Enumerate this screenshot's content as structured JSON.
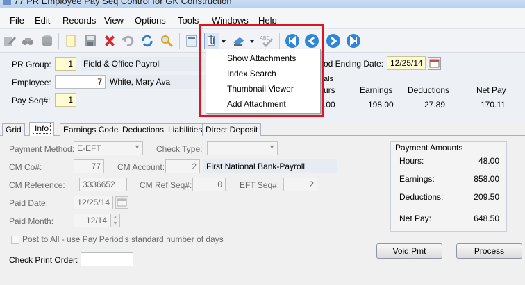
{
  "window": {
    "title": "77 PR Employee Pay Seq Control for GK Construction"
  },
  "menu": [
    "File",
    "Edit",
    "Records",
    "View",
    "Options",
    "Tools",
    "Windows",
    "Help"
  ],
  "header": {
    "pr_group_label": "PR Group:",
    "pr_group_value": "1",
    "pr_group_desc": "Field & Office Payroll",
    "employee_label": "Employee:",
    "employee_value": "7",
    "employee_name": "White, Mary Ava",
    "payseq_label": "Pay Seq#:",
    "payseq_value": "1",
    "period_ending_label": "od Ending Date:",
    "period_ending_value": "12/25/14",
    "totals_label": "als",
    "totals_headers": [
      "urs",
      "Earnings",
      "Deductions",
      "Net Pay"
    ],
    "totals_values": [
      ".00",
      "198.00",
      "27.89",
      "170.11"
    ]
  },
  "attachments_menu": {
    "items": [
      "Show Attachments",
      "Index Search",
      "Thumbnail Viewer",
      "Add Attachment"
    ]
  },
  "tabs": [
    "Grid",
    "Info",
    "Earnings Codes",
    "Deductions",
    "Liabilities",
    "Direct Deposit"
  ],
  "info": {
    "payment_method_label": "Payment Method:",
    "payment_method_value": "E-EFT",
    "check_type_label": "Check Type:",
    "check_type_value": "",
    "cm_co_label": "CM Co#:",
    "cm_co_value": "77",
    "cm_account_label": "CM Account:",
    "cm_account_value": "2",
    "cm_account_desc": "First National Bank-Payroll",
    "cm_reference_label": "CM Reference:",
    "cm_reference_value": "3336652",
    "cm_ref_seq_label": "CM Ref Seq#:",
    "cm_ref_seq_value": "0",
    "eft_seq_label": "EFT Seq#:",
    "eft_seq_value": "2",
    "paid_date_label": "Paid Date:",
    "paid_date_value": "12/25/14",
    "paid_month_label": "Paid Month:",
    "paid_month_value": "12/14",
    "post_to_all_label": "Post to All - use Pay Period's standard number of days",
    "check_print_order_label": "Check Print Order:",
    "check_print_order_value": ""
  },
  "payment_amounts": {
    "title": "Payment Amounts",
    "hours_label": "Hours:",
    "hours_value": "48.00",
    "earnings_label": "Earnings:",
    "earnings_value": "858.00",
    "deductions_label": "Deductions:",
    "deductions_value": "209.50",
    "netpay_label": "Net Pay:",
    "netpay_value": "648.50"
  },
  "buttons": {
    "void_pmt": "Void Pmt",
    "process": "Process"
  },
  "colors": {
    "highlight": "#e0141e",
    "required_field": "#fffcd3"
  }
}
